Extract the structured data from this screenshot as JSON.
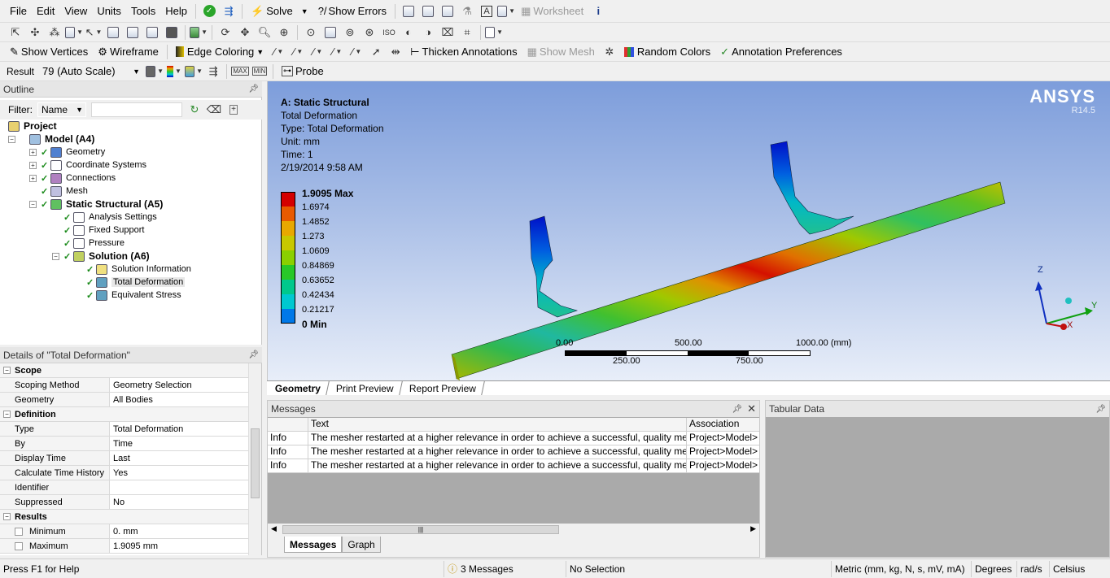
{
  "menu": {
    "items": [
      "File",
      "Edit",
      "View",
      "Units",
      "Tools",
      "Help"
    ],
    "solve": "Solve",
    "show_errors": "Show Errors",
    "worksheet": "Worksheet"
  },
  "toolbar3": {
    "show_vertices": "Show Vertices",
    "wireframe": "Wireframe",
    "edge_coloring": "Edge Coloring",
    "thicken_annotations": "Thicken Annotations",
    "show_mesh": "Show Mesh",
    "random_colors": "Random Colors",
    "annotation_preferences": "Annotation Preferences"
  },
  "toolbar4": {
    "result_label": "Result",
    "result_value": "79 (Auto Scale)",
    "probe": "Probe"
  },
  "outline": {
    "title": "Outline",
    "filter_label": "Filter:",
    "filter_value": "Name",
    "tree": [
      {
        "label": "Project",
        "bold": true
      },
      {
        "label": "Model (A4)",
        "bold": true
      },
      {
        "label": "Geometry"
      },
      {
        "label": "Coordinate Systems"
      },
      {
        "label": "Connections"
      },
      {
        "label": "Mesh"
      },
      {
        "label": "Static Structural (A5)",
        "bold": true
      },
      {
        "label": "Analysis Settings"
      },
      {
        "label": "Fixed Support"
      },
      {
        "label": "Pressure"
      },
      {
        "label": "Solution (A6)",
        "bold": true
      },
      {
        "label": "Solution Information"
      },
      {
        "label": "Total Deformation",
        "selected": true
      },
      {
        "label": "Equivalent Stress"
      }
    ]
  },
  "details": {
    "title": "Details of \"Total Deformation\"",
    "rows": [
      {
        "cat": true,
        "k": "Scope"
      },
      {
        "k": "Scoping Method",
        "v": "Geometry Selection"
      },
      {
        "k": "Geometry",
        "v": "All Bodies"
      },
      {
        "cat": true,
        "k": "Definition"
      },
      {
        "k": "Type",
        "v": "Total Deformation"
      },
      {
        "k": "By",
        "v": "Time"
      },
      {
        "k": "Display Time",
        "v": "Last"
      },
      {
        "k": "Calculate Time History",
        "v": "Yes"
      },
      {
        "k": "Identifier",
        "v": ""
      },
      {
        "k": "Suppressed",
        "v": "No"
      },
      {
        "cat": true,
        "k": "Results"
      },
      {
        "k": "Minimum",
        "v": "0. mm",
        "cb": true
      },
      {
        "k": "Maximum",
        "v": "1.9095 mm",
        "cb": true
      }
    ]
  },
  "viewport": {
    "title": "A: Static Structural",
    "lines": [
      "Total Deformation",
      "Type: Total Deformation",
      "Unit: mm",
      "Time: 1",
      "2/19/2014 9:58 AM"
    ],
    "brand": "ANSYS",
    "release": "R14.5",
    "legend": [
      {
        "label": "1.9095 Max",
        "color": "#d40000",
        "bold": true
      },
      {
        "label": "1.6974",
        "color": "#e85a00"
      },
      {
        "label": "1.4852",
        "color": "#e8a800"
      },
      {
        "label": "1.273",
        "color": "#c8c800"
      },
      {
        "label": "1.0609",
        "color": "#8ad000"
      },
      {
        "label": "0.84869",
        "color": "#28c828"
      },
      {
        "label": "0.63652",
        "color": "#00c88c"
      },
      {
        "label": "0.42434",
        "color": "#00c8d0"
      },
      {
        "label": "0.21217",
        "color": "#0078e8"
      },
      {
        "label": "0 Min",
        "color": "#0000c8",
        "bold": true
      }
    ],
    "scale": {
      "top": [
        "0.00",
        "500.00",
        "1000.00 (mm)"
      ],
      "bottom": [
        "250.00",
        "750.00"
      ]
    },
    "triad": {
      "z": "Z",
      "x": "X",
      "y": "Y"
    },
    "tabs": [
      "Geometry",
      "Print Preview",
      "Report Preview"
    ]
  },
  "messages": {
    "title": "Messages",
    "columns": [
      "",
      "Text",
      "Association"
    ],
    "rows": [
      {
        "type": "Info",
        "text": "The mesher restarted at a higher relevance in order to achieve a successful, quality mes",
        "assoc": "Project>Model>"
      },
      {
        "type": "Info",
        "text": "The mesher restarted at a higher relevance in order to achieve a successful, quality mes",
        "assoc": "Project>Model>"
      },
      {
        "type": "Info",
        "text": "The mesher restarted at a higher relevance in order to achieve a successful, quality mes",
        "assoc": "Project>Model>"
      }
    ],
    "tabs": [
      "Messages",
      "Graph"
    ]
  },
  "tabular": {
    "title": "Tabular Data"
  },
  "status": {
    "help": "Press F1 for Help",
    "messages": "3 Messages",
    "selection": "No Selection",
    "units": "Metric (mm, kg, N, s, mV, mA)",
    "angle": "Degrees",
    "rate": "rad/s",
    "temp": "Celsius"
  }
}
